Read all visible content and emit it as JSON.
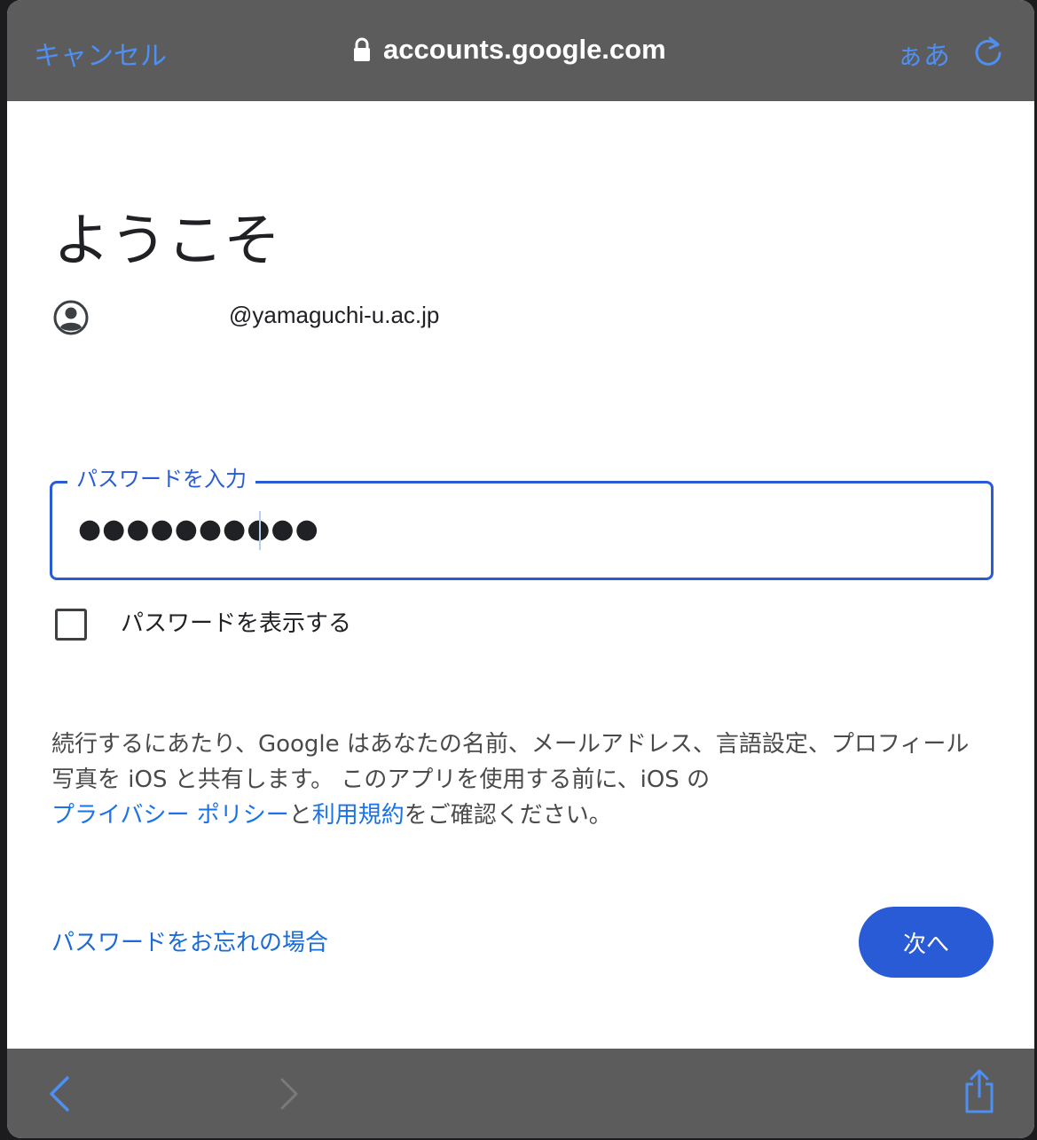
{
  "browser": {
    "cancel_label": "キャンセル",
    "url": "accounts.google.com",
    "text_size_label": "ぁあ"
  },
  "signin": {
    "title": "ようこそ",
    "account_email": "@yamaguchi-u.ac.jp",
    "password_label": "パスワードを入力",
    "password_masked": "●●●●●●●●●●",
    "show_password_label": "パスワードを表示する",
    "show_password_checked": false,
    "disclaimer_text": "続行するにあたり、Google はあなたの名前、メールアドレス、言語設定、プロフィール写真を iOS と共有します。 このアプリを使用する前に、iOS の",
    "privacy_link": "プライバシー ポリシー",
    "and_text": "と",
    "terms_link": "利用規約",
    "confirm_text": "をご確認ください。",
    "forgot_password": "パスワードをお忘れの場合",
    "next_button": "次へ"
  },
  "colors": {
    "accent": "#2a5bd7",
    "ios_blue": "#4d8ff2",
    "bar_gray": "#5c5c5c"
  },
  "icons": {
    "lock": "lock-icon",
    "reload": "reload-icon",
    "account": "account-circle-icon",
    "back": "chevron-left-icon",
    "forward": "chevron-right-icon",
    "share": "share-icon"
  }
}
